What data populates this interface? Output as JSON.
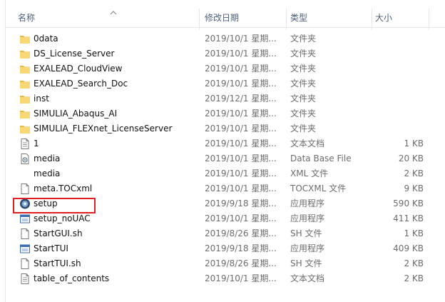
{
  "columns": {
    "name": "名称",
    "date": "修改日期",
    "type": "类型",
    "size": "大小"
  },
  "files": [
    {
      "name": "0data",
      "date": "2019/10/1 星期...",
      "type": "文件夹",
      "size": "",
      "icon": "folder-icon"
    },
    {
      "name": "DS_License_Server",
      "date": "2019/10/1 星期...",
      "type": "文件夹",
      "size": "",
      "icon": "folder-icon"
    },
    {
      "name": "EXALEAD_CloudView",
      "date": "2019/10/1 星期...",
      "type": "文件夹",
      "size": "",
      "icon": "folder-icon"
    },
    {
      "name": "EXALEAD_Search_Doc",
      "date": "2019/10/1 星期...",
      "type": "文件夹",
      "size": "",
      "icon": "folder-icon"
    },
    {
      "name": "inst",
      "date": "2019/12/1 星期...",
      "type": "文件夹",
      "size": "",
      "icon": "folder-icon"
    },
    {
      "name": "SIMULIA_Abaqus_AI",
      "date": "2019/10/1 星期...",
      "type": "文件夹",
      "size": "",
      "icon": "folder-icon"
    },
    {
      "name": "SIMULIA_FLEXnet_LicenseServer",
      "date": "2019/10/1 星期...",
      "type": "文件夹",
      "size": "",
      "icon": "folder-icon"
    },
    {
      "name": "1",
      "date": "2019/10/1 星期...",
      "type": "文本文档",
      "size": "1 KB",
      "icon": "text-document-icon"
    },
    {
      "name": "media",
      "date": "2019/10/1 星期...",
      "type": "Data Base File",
      "size": "20 KB",
      "icon": "database-file-icon"
    },
    {
      "name": "media",
      "date": "2019/10/1 星期...",
      "type": "XML 文件",
      "size": "2 KB",
      "icon": "xml-file-icon"
    },
    {
      "name": "meta.TOCxml",
      "date": "2019/10/1 星期...",
      "type": "TOCXML 文件",
      "size": "9 KB",
      "icon": "blank-file-icon"
    },
    {
      "name": "setup",
      "date": "2019/9/18 星期...",
      "type": "应用程序",
      "size": "590 KB",
      "icon": "setup-app-icon"
    },
    {
      "name": "setup_noUAC",
      "date": "2019/10/1 星期...",
      "type": "应用程序",
      "size": "411 KB",
      "icon": "app-window-icon"
    },
    {
      "name": "StartGUI.sh",
      "date": "2019/8/26 星期...",
      "type": "SH 文件",
      "size": "1 KB",
      "icon": "blank-file-icon"
    },
    {
      "name": "StartTUI",
      "date": "2019/9/18 星期...",
      "type": "应用程序",
      "size": "409 KB",
      "icon": "app-window-icon"
    },
    {
      "name": "StartTUI.sh",
      "date": "2019/8/26 星期...",
      "type": "SH 文件",
      "size": "2 KB",
      "icon": "blank-file-icon"
    },
    {
      "name": "table_of_contents",
      "date": "2019/10/1 星期...",
      "type": "文本文档",
      "size": "2 KB",
      "icon": "text-document-icon"
    }
  ],
  "colors": {
    "folder": "#f8d775",
    "folder_dark": "#e6b84a",
    "highlight": "#e02020",
    "header_text": "#4c607a"
  }
}
